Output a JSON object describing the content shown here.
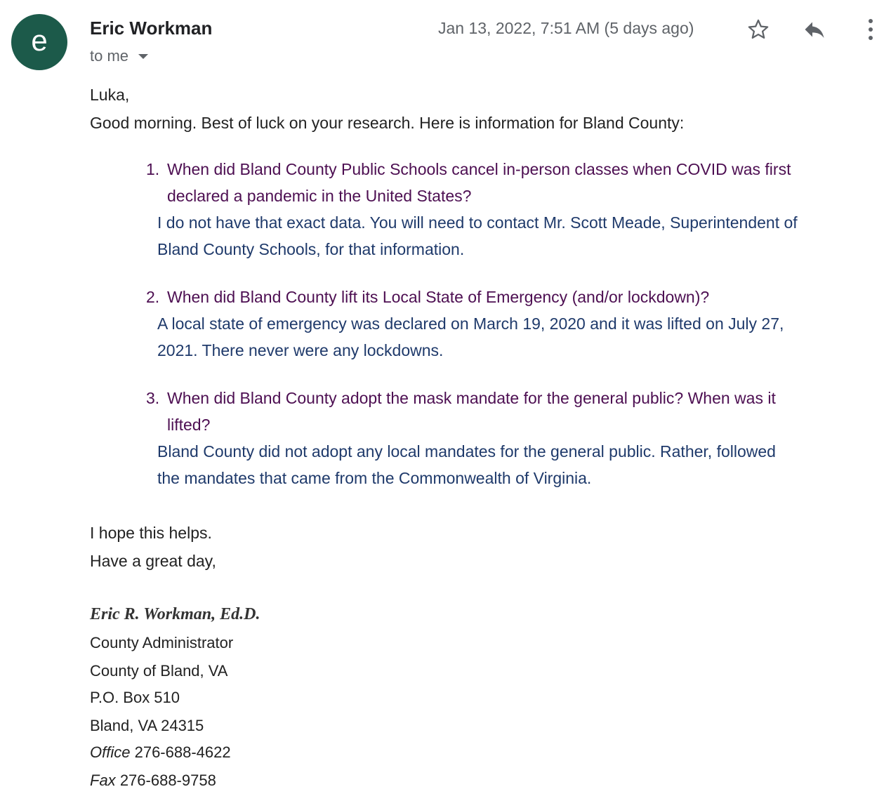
{
  "header": {
    "avatar_letter": "e",
    "avatar_color": "#1c5a4a",
    "sender_name": "Eric Workman",
    "recipient_label": "to me",
    "date": "Jan 13, 2022, 7:51 AM (5 days ago)",
    "icons": [
      "star-icon",
      "reply-icon",
      "more-vert-icon"
    ]
  },
  "body": {
    "greeting": "Luka,",
    "intro": "Good morning. Best of luck on your research. Here is information for Bland County:",
    "items": [
      {
        "number": "1.",
        "question_line1": "When did Bland County Public Schools cancel in-person classes when COVID was first",
        "question_line2": "declared a pandemic in the United States?",
        "answer_line1": "I do not have that exact data. You will need to contact Mr. Scott Meade, Superintendent of",
        "answer_line2": "Bland County Schools, for that information."
      },
      {
        "number": "2.",
        "question_line1": "When did Bland County lift its Local State of Emergency (and/or lockdown)?",
        "question_line2": "",
        "answer_line1": "A local state of emergency was declared on March 19, 2020 and it was lifted on July 27,",
        "answer_line2": "2021. There never were any lockdowns."
      },
      {
        "number": "3.",
        "question_line1": "When did Bland County adopt the mask mandate for the general public? When was it",
        "question_line2": "lifted?",
        "answer_line1": "Bland County did not adopt any local mandates for the general public. Rather, followed",
        "answer_line2": "the mandates that came from the Commonwealth of Virginia."
      }
    ],
    "closing1": "I hope this helps.",
    "closing2": "Have a great day,"
  },
  "signature": {
    "name": "Eric R. Workman, Ed.D.",
    "title": "County Administrator",
    "org": "County of Bland, VA",
    "po_box": "P.O. Box 510",
    "city": "Bland, VA 24315",
    "office_label": "Office",
    "office_number": "276-688-4622",
    "fax_label": "Fax",
    "fax_number": "276-688-9758"
  },
  "colors": {
    "question": "#4d0f52",
    "answer": "#1f3a6b"
  }
}
